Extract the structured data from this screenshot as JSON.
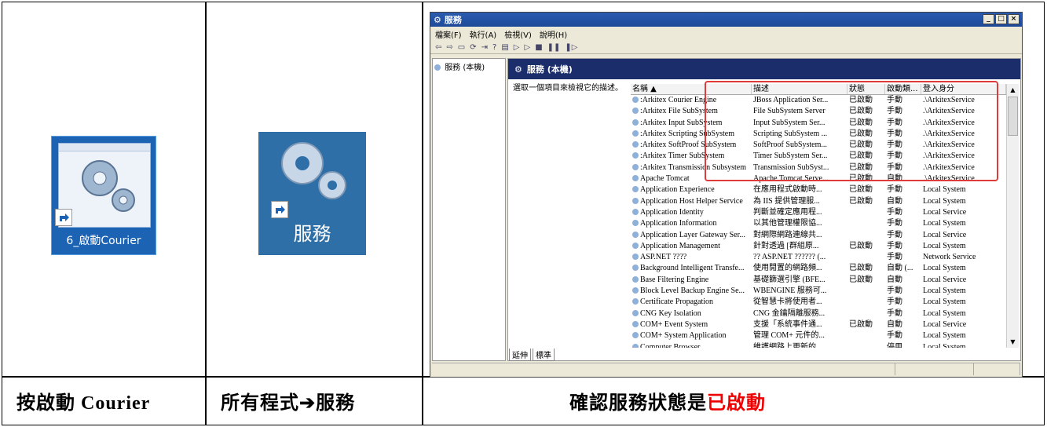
{
  "captions": {
    "col1": "按啟動 Courier",
    "col2": "所有程式➔服務",
    "col3_prefix": "確認服務狀態是",
    "col3_highlight": "已啟動"
  },
  "icons": {
    "shortcut1_label": "6_啟動Courier",
    "shortcut2_label": "服務"
  },
  "window": {
    "title": "服務",
    "controls": [
      "_",
      "□",
      "×"
    ],
    "menu": [
      "檔案(F)",
      "執行(A)",
      "檢視(V)",
      "說明(H)"
    ],
    "tree_item": "服務 (本機)",
    "pane_title": "服務 (本機)",
    "description": "選取一個項目來檢視它的描述。",
    "columns": [
      "名稱 ▲",
      "描述",
      "狀態",
      "啟動類...",
      "登入身分"
    ],
    "rows": [
      [
        ":Arkitex Courier Engine",
        "JBoss Application Ser...",
        "已啟動",
        "手動",
        ".\\ArkitexService"
      ],
      [
        ":Arkitex File SubSystem",
        "File SubSystem Server",
        "已啟動",
        "手動",
        ".\\ArkitexService"
      ],
      [
        ":Arkitex Input SubSystem",
        "Input SubSystem Ser...",
        "已啟動",
        "手動",
        ".\\ArkitexService"
      ],
      [
        ":Arkitex Scripting SubSystem",
        "Scripting SubSystem ...",
        "已啟動",
        "手動",
        ".\\ArkitexService"
      ],
      [
        ":Arkitex SoftProof SubSystem",
        "SoftProof SubSystem...",
        "已啟動",
        "手動",
        ".\\ArkitexService"
      ],
      [
        ":Arkitex Timer SubSystem",
        "Timer SubSystem Ser...",
        "已啟動",
        "手動",
        ".\\ArkitexService"
      ],
      [
        ":Arkitex Transmission Subsystem",
        "Transmission SubSyst...",
        "已啟動",
        "手動",
        ".\\ArkitexService"
      ],
      [
        "Apache Tomcat",
        "Apache Tomcat Serve...",
        "已啟動",
        "自動",
        ".\\ArkitexService"
      ],
      [
        "Application Experience",
        "在應用程式啟動時...",
        "已啟動",
        "手動",
        "Local System"
      ],
      [
        "Application Host Helper Service",
        "為 IIS 提供管理服...",
        "已啟動",
        "自動",
        "Local System"
      ],
      [
        "Application Identity",
        "判斷並確定應用程...",
        "",
        "手動",
        "Local Service"
      ],
      [
        "Application Information",
        "以其他管理權限協...",
        "",
        "手動",
        "Local System"
      ],
      [
        "Application Layer Gateway Ser...",
        "對網際網路連線共...",
        "",
        "手動",
        "Local Service"
      ],
      [
        "Application Management",
        "針對透過 [群組原...",
        "已啟動",
        "手動",
        "Local System"
      ],
      [
        "ASP.NET ????",
        "?? ASP.NET ?????? (...",
        "",
        "手動",
        "Network Service"
      ],
      [
        "Background Intelligent Transfe...",
        "使用閒置的網路頻...",
        "已啟動",
        "自動 (...",
        "Local System"
      ],
      [
        "Base Filtering Engine",
        "基礎篩選引擎 (BFE...",
        "已啟動",
        "自動",
        "Local Service"
      ],
      [
        "Block Level Backup Engine Se...",
        "WBENGINE 服務可...",
        "",
        "手動",
        "Local System"
      ],
      [
        "Certificate Propagation",
        "從智慧卡將使用者...",
        "",
        "手動",
        "Local System"
      ],
      [
        "CNG Key Isolation",
        "CNG 金鑰隔離服務...",
        "",
        "手動",
        "Local System"
      ],
      [
        "COM+ Event System",
        "支援「系統事件通...",
        "已啟動",
        "自動",
        "Local Service"
      ],
      [
        "COM+ System Application",
        "管理 COM+ 元件的...",
        "",
        "手動",
        "Local System"
      ],
      [
        "Computer Browser",
        "維護網路上更新的...",
        "",
        "停用",
        "Local System"
      ]
    ],
    "tabs": [
      "延伸",
      "標準"
    ]
  }
}
